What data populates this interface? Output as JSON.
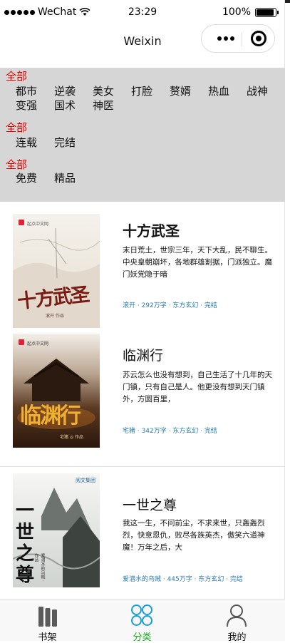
{
  "status_bar": {
    "carrier": "WeChat",
    "time": "23:29",
    "battery": "100%"
  },
  "nav": {
    "title": "Weixin"
  },
  "filters": [
    {
      "all_label": "全部",
      "options": [
        "都市",
        "逆袭",
        "美女",
        "打脸",
        "赘婿",
        "热血",
        "战神",
        "变强",
        "国术",
        "神医"
      ]
    },
    {
      "all_label": "全部",
      "options": [
        "连载",
        "完结"
      ]
    },
    {
      "all_label": "全部",
      "options": [
        "免费",
        "精品"
      ]
    }
  ],
  "books": [
    {
      "title": "十方武圣",
      "desc": "末日荒土，世宗三年，天下大乱，民不聊生。中央皇朝崩坏，各地群雄割据，门派独立。魔门妖党隐于暗",
      "meta": "滚开 · 292万字 · 东方玄幻 · 完结",
      "cover_text": "十方武圣",
      "cover_publisher": "起点中文网",
      "cover_author": "滚开 作品"
    },
    {
      "title": "临渊行",
      "desc": "苏云怎么也没有想到，自己生活了十几年的天门镇，只有自己是人。他更没有想到天门镇外，方圆百里，",
      "meta": "宅猪 · 342万字 · 东方玄幻 · 完结",
      "cover_text": "临渊行",
      "cover_publisher": "起点中文网",
      "cover_author": "宅猪 ◎ 作品"
    },
    {
      "title": "一世之尊",
      "desc": "我这一生，不问前尘，不求来世，只轰轰烈烈，快意恩仇，败尽各族英杰，傲笑六道神魔！万年之后，大",
      "meta": "爱潜水的乌贼 · 445万字 · 东方玄幻 · 完结",
      "cover_text": "一世之尊",
      "cover_publisher": "阅文集团",
      "cover_author": "爱潜水的乌贼 · 作品"
    }
  ],
  "tabs": [
    {
      "label": "书架",
      "icon": "bookshelf-icon",
      "active": false
    },
    {
      "label": "分类",
      "icon": "category-icon",
      "active": true
    },
    {
      "label": "我的",
      "icon": "profile-icon",
      "active": false
    }
  ],
  "colors": {
    "accent_red": "#e00000",
    "tab_active": "#1aad19",
    "meta_blue": "#2a7ab0",
    "filter_bg": "#d6d6d6"
  }
}
